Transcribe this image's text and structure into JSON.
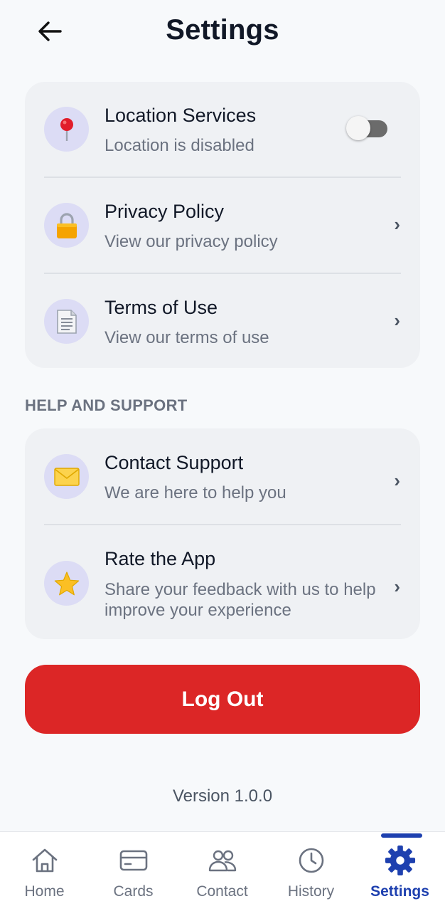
{
  "header": {
    "title": "Settings",
    "back_icon": "arrow-left-icon"
  },
  "general": {
    "items": [
      {
        "title": "Location Services",
        "subtitle": "Location is disabled",
        "icon": "map-pin-icon",
        "toggle": false
      },
      {
        "title": "Privacy Policy",
        "subtitle": "View our privacy policy",
        "icon": "lock-icon",
        "chevron": "›"
      },
      {
        "title": "Terms of Use",
        "subtitle": "View our terms of use",
        "icon": "document-icon",
        "chevron": "›"
      }
    ]
  },
  "help": {
    "label": "HELP AND SUPPORT",
    "items": [
      {
        "title": "Contact Support",
        "subtitle": "We are here to help you",
        "icon": "envelope-icon",
        "chevron": "›"
      },
      {
        "title": "Rate the App",
        "subtitle": "Share your feedback with us to help improve your experience",
        "icon": "star-icon",
        "chevron": "›"
      }
    ]
  },
  "logout": {
    "label": "Log Out"
  },
  "version": "Version 1.0.0",
  "nav": {
    "items": [
      {
        "label": "Home",
        "icon": "home-icon"
      },
      {
        "label": "Cards",
        "icon": "card-icon"
      },
      {
        "label": "Contact",
        "icon": "users-icon"
      },
      {
        "label": "History",
        "icon": "clock-icon"
      },
      {
        "label": "Settings",
        "icon": "gear-icon",
        "active": true
      }
    ]
  },
  "colors": {
    "accent": "#1e40af",
    "danger": "#dc2626",
    "icon_bg": "#dcdcf5"
  }
}
